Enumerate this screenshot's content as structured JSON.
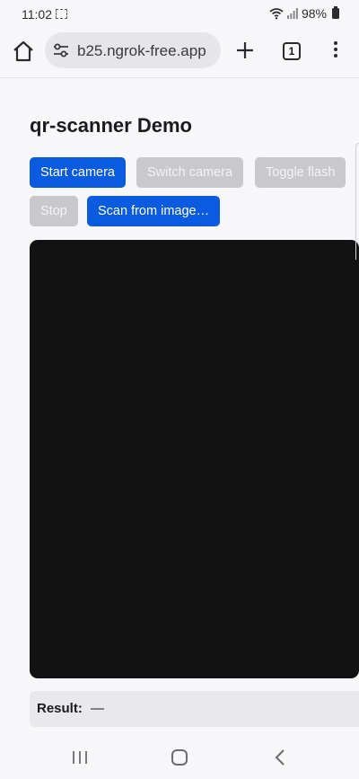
{
  "status_bar": {
    "time": "11:02",
    "battery": "98%"
  },
  "browser": {
    "url": "b25.ngrok-free.app",
    "tab_count": "1"
  },
  "page": {
    "title": "qr-scanner Demo",
    "buttons": {
      "start_camera": "Start camera",
      "switch_camera": "Switch camera",
      "toggle_flash": "Toggle flash",
      "stop": "Stop",
      "scan_from_image": "Scan from image…"
    },
    "result": {
      "label": "Result:",
      "value": "—"
    }
  },
  "colors": {
    "primary_button": "#0b5be0",
    "disabled_button": "#c9c9cc",
    "video_background": "#121212"
  }
}
